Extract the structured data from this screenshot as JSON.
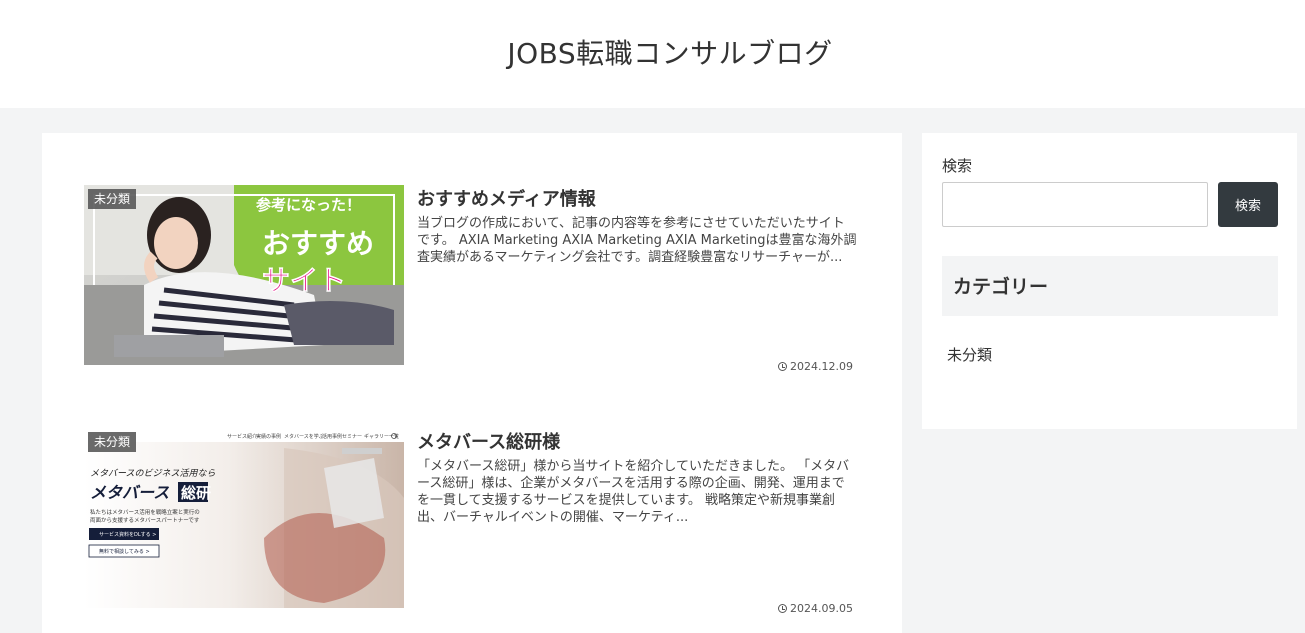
{
  "header": {
    "site_title": "JOBS転職コンサルブログ"
  },
  "entries": [
    {
      "category": "未分類",
      "title": "おすすめメディア情報",
      "snippet": "当ブログの作成において、記事の内容等を参考にさせていただいたサイトです。 AXIA Marketing AXIA Marketing AXIA Marketingは豊富な海外調査実績があるマーケティング会社です。調査経験豊富なリサーチャーが...",
      "date": "2024.12.09",
      "thumb": {
        "top_text": "参考になった！",
        "line1": "おすすめ",
        "line2": "サイト"
      }
    },
    {
      "category": "未分類",
      "title": "メタバース総研様",
      "snippet": "「メタバース総研」様から当サイトを紹介していただきました。 「メタバース総研」様は、企業がメタバースを活用する際の企画、開発、運用までを一貫して支援するサービスを提供しています。 戦略策定や新規事業創出、バーチャルイベントの開催、マーケティ...",
      "date": "2024.09.05",
      "thumb": {
        "nav_items": [
          "サービス紹介",
          "実績の事例",
          "メタバースを学ぶ",
          "活用事例",
          "セミナー",
          "ギャラリー一覧"
        ],
        "tagline": "メタバースのビジネス活用なら",
        "brand": "メタバース",
        "brand_box": "総研",
        "desc1": "私たちはメタバース活用を戦略立案と実行の",
        "desc2": "両面から支援するメタバースパートナーです",
        "btn1": "サービス資料をDLする >",
        "btn2": "無料で相談してみる >"
      }
    }
  ],
  "sidebar": {
    "search_label": "検索",
    "search_placeholder": "",
    "search_button": "検索",
    "category_heading": "カテゴリー",
    "categories": [
      "未分類"
    ]
  },
  "colors": {
    "page_bg": "#f3f4f5",
    "accent_dark": "#333a3f",
    "thumb_green": "#8cc63f",
    "thumb_pink": "#e4007f"
  }
}
